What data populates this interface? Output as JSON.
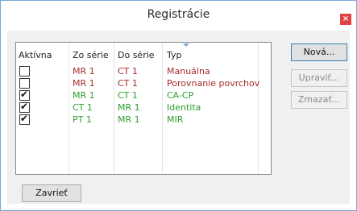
{
  "window": {
    "title": "Registrácie",
    "close_glyph": "×"
  },
  "list": {
    "columns": [
      "Aktívna",
      "Zo série",
      "Do série",
      "Typ"
    ],
    "rows": [
      {
        "active": false,
        "from": "MR 1",
        "to": "CT 1",
        "type": "Manuálna",
        "color": "#a52a2a"
      },
      {
        "active": false,
        "from": "MR 1",
        "to": "CT 1",
        "type": "Porovnanie povrchov",
        "color": "#a52a2a"
      },
      {
        "active": true,
        "from": "MR 1",
        "to": "CT 1",
        "type": "CA-CP",
        "color": "#2e9e2e"
      },
      {
        "active": true,
        "from": "CT 1",
        "to": "MR 1",
        "type": "Identita",
        "color": "#2e9e2e"
      },
      {
        "active": true,
        "from": "PT 1",
        "to": "MR 1",
        "type": "MIR",
        "color": "#2e9e2e"
      }
    ]
  },
  "buttons": {
    "new": "Nová...",
    "edit": "Upraviť...",
    "delete": "Zmazať...",
    "close": "Zavrieť"
  },
  "colors": {
    "titlebar_border": "#7aa6d8",
    "close": "#e04343",
    "active_text": "#2e9e2e",
    "inactive_text": "#a52a2a"
  }
}
